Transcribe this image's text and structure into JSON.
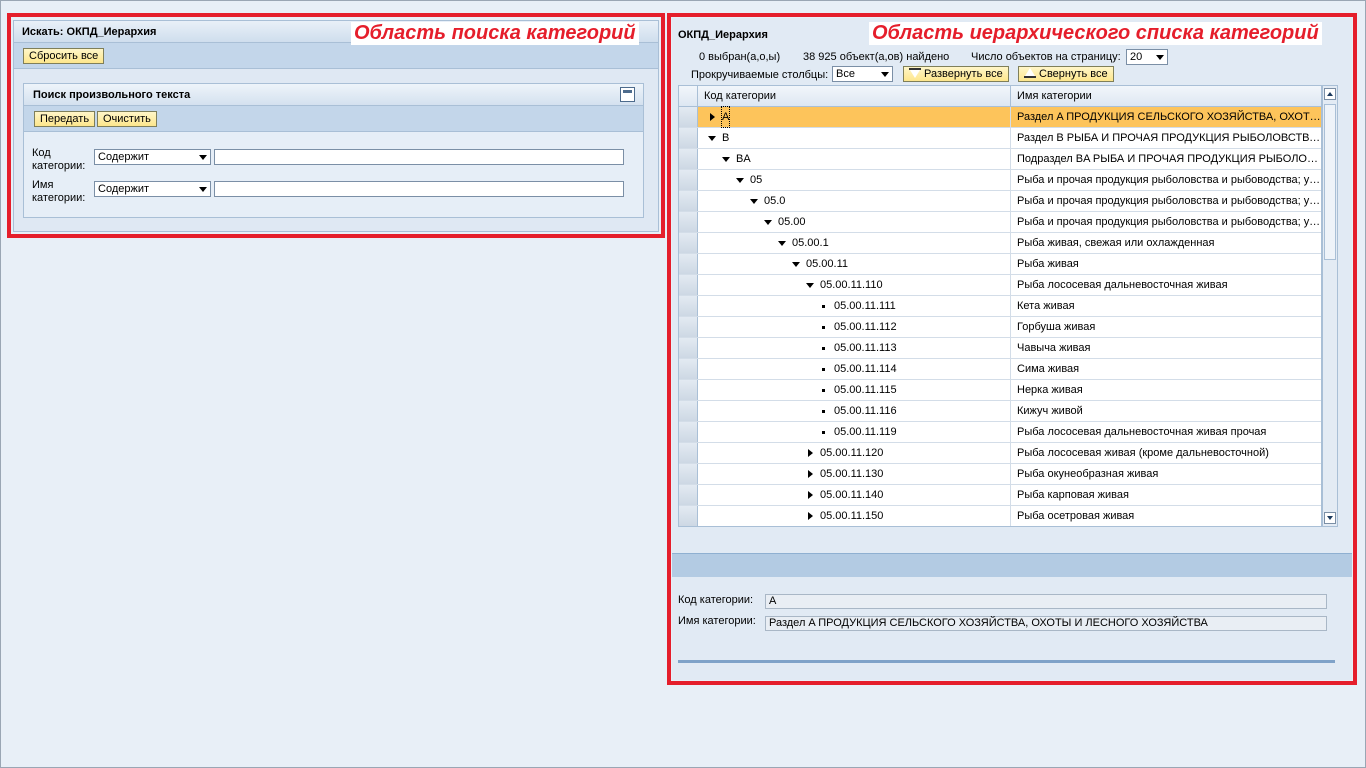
{
  "search": {
    "title": "Искать: ОКПД_Иерархия",
    "reset_all": "Сбросить все",
    "annotation": "Область поиска категорий",
    "freetext": {
      "title": "Поиск произвольного текста",
      "submit": "Передать",
      "clear": "Очистить",
      "code_label": "Код категории:",
      "name_label": "Имя категории:",
      "code_operator": "Содержит",
      "name_operator": "Содержит",
      "code_value": "",
      "name_value": ""
    }
  },
  "tree": {
    "title": "ОКПД_Иерархия",
    "annotation": "Область иерархического списка категорий",
    "selected_count": "0 выбран(а,о,ы)",
    "found_count": "38 925 объект(а,ов) найдено",
    "per_page_label": "Число объектов на страницу:",
    "per_page_value": "20",
    "scroll_cols_label": "Прокручиваемые столбцы:",
    "scroll_cols_value": "Все",
    "expand_all": "Развернуть все",
    "collapse_all": "Свернуть все",
    "columns": {
      "code": "Код категории",
      "name": "Имя категории"
    },
    "rows": [
      {
        "code": "A",
        "name": "Раздел A ПРОДУКЦИЯ СЕЛЬСКОГО ХОЗЯЙСТВА, ОХОТЫ И ЛЕСНОГО ХОЗЯЙСТВА",
        "level": 0,
        "state": "collapsed",
        "selected": true
      },
      {
        "code": "B",
        "name": "Раздел B РЫБА И ПРОЧАЯ ПРОДУКЦИЯ РЫБОЛОВСТВА И РЫБОВОДСТВА",
        "level": 0,
        "state": "expanded",
        "selected": false
      },
      {
        "code": "BA",
        "name": "Подраздел BA РЫБА И ПРОЧАЯ ПРОДУКЦИЯ РЫБОЛОВСТВА И РЫБОВОДСТВА",
        "level": 1,
        "state": "expanded",
        "selected": false
      },
      {
        "code": "05",
        "name": "Рыба и прочая продукция рыболовства и рыбоводства; услуги, связанные с рыболовством",
        "level": 2,
        "state": "expanded",
        "selected": false
      },
      {
        "code": "05.0",
        "name": "Рыба и прочая продукция рыболовства и рыбоводства; услуги, связанные с рыболовством",
        "level": 3,
        "state": "expanded",
        "selected": false
      },
      {
        "code": "05.00",
        "name": "Рыба и прочая продукция рыболовства и рыбоводства; услуги, связанные с рыболовством",
        "level": 4,
        "state": "expanded",
        "selected": false
      },
      {
        "code": "05.00.1",
        "name": "Рыба живая, свежая или охлажденная",
        "level": 5,
        "state": "expanded",
        "selected": false
      },
      {
        "code": "05.00.11",
        "name": "Рыба живая",
        "level": 6,
        "state": "expanded",
        "selected": false
      },
      {
        "code": "05.00.11.110",
        "name": "Рыба лососевая дальневосточная живая",
        "level": 7,
        "state": "expanded",
        "selected": false
      },
      {
        "code": "05.00.11.111",
        "name": "Кета живая",
        "level": 8,
        "state": "leaf",
        "selected": false
      },
      {
        "code": "05.00.11.112",
        "name": "Горбуша живая",
        "level": 8,
        "state": "leaf",
        "selected": false
      },
      {
        "code": "05.00.11.113",
        "name": "Чавыча живая",
        "level": 8,
        "state": "leaf",
        "selected": false
      },
      {
        "code": "05.00.11.114",
        "name": "Сима живая",
        "level": 8,
        "state": "leaf",
        "selected": false
      },
      {
        "code": "05.00.11.115",
        "name": "Нерка живая",
        "level": 8,
        "state": "leaf",
        "selected": false
      },
      {
        "code": "05.00.11.116",
        "name": "Кижуч живой",
        "level": 8,
        "state": "leaf",
        "selected": false
      },
      {
        "code": "05.00.11.119",
        "name": "Рыба лососевая дальневосточная живая прочая",
        "level": 8,
        "state": "leaf",
        "selected": false
      },
      {
        "code": "05.00.11.120",
        "name": "Рыба лососевая живая (кроме дальневосточной)",
        "level": 7,
        "state": "collapsed",
        "selected": false
      },
      {
        "code": "05.00.11.130",
        "name": "Рыба окунеобразная живая",
        "level": 7,
        "state": "collapsed",
        "selected": false
      },
      {
        "code": "05.00.11.140",
        "name": "Рыба карповая живая",
        "level": 7,
        "state": "collapsed",
        "selected": false
      },
      {
        "code": "05.00.11.150",
        "name": "Рыба осетровая живая",
        "level": 7,
        "state": "collapsed",
        "selected": false
      }
    ],
    "detail": {
      "code_label": "Код категории:",
      "code_value": "A",
      "name_label": "Имя категории:",
      "name_value": "Раздел A ПРОДУКЦИЯ СЕЛЬСКОГО ХОЗЯЙСТВА, ОХОТЫ И ЛЕСНОГО ХОЗЯЙСТВА"
    }
  },
  "colors": {
    "annotation_red": "#e51e2b",
    "selected_row": "#fdc45b",
    "button_yellow": "#fde68c"
  }
}
